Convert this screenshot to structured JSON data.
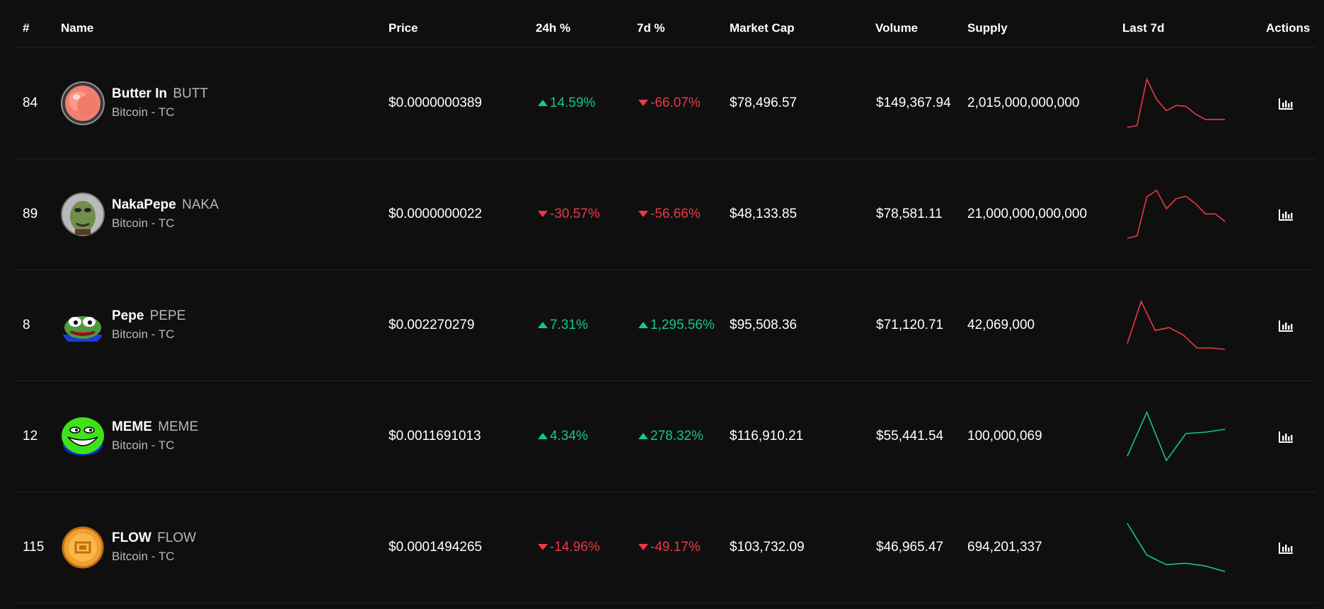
{
  "colors": {
    "background": "#0f0f10",
    "positive": "#16c784",
    "negative": "#ea3943",
    "spark_up": "#16c784",
    "spark_down": "#ea3943"
  },
  "header": {
    "rank": "#",
    "name": "Name",
    "price": "Price",
    "change_24h": "24h %",
    "change_7d": "7d %",
    "market_cap": "Market Cap",
    "volume": "Volume",
    "supply": "Supply",
    "last_7d": "Last 7d",
    "actions": "Actions"
  },
  "rows": [
    {
      "rank": "84",
      "name": "Butter In",
      "symbol": "BUTT",
      "network": "Bitcoin - TC",
      "icon": "peach-icon",
      "price": "$0.0000000389",
      "change_24h": "14.59%",
      "change_24h_dir": "up",
      "change_7d": "-66.07%",
      "change_7d_dir": "down",
      "market_cap": "$78,496.57",
      "volume": "$149,367.94",
      "supply": "2,015,000,000,000",
      "spark_dir": "down",
      "spark": [
        5,
        7,
        60,
        37,
        24,
        30,
        29,
        20,
        14,
        14,
        14
      ]
    },
    {
      "rank": "89",
      "name": "NakaPepe",
      "symbol": "NAKA",
      "network": "Bitcoin - TC",
      "icon": "naka-pepe-icon",
      "price": "$0.0000000022",
      "change_24h": "-30.57%",
      "change_24h_dir": "down",
      "change_7d": "-56.66%",
      "change_7d_dir": "down",
      "market_cap": "$48,133.85",
      "volume": "$78,581.11",
      "supply": "21,000,000,000,000",
      "spark_dir": "down",
      "spark": [
        5,
        8,
        54,
        62,
        40,
        52,
        55,
        46,
        34,
        34,
        25
      ]
    },
    {
      "rank": "8",
      "name": "Pepe",
      "symbol": "PEPE",
      "network": "Bitcoin - TC",
      "icon": "pepe-frog-icon",
      "price": "$0.002270279",
      "change_24h": "7.31%",
      "change_24h_dir": "up",
      "change_7d": "1,295.56%",
      "change_7d_dir": "up",
      "market_cap": "$95,508.36",
      "volume": "$71,120.71",
      "supply": "42,069,000",
      "spark_dir": "down",
      "spark": [
        12,
        70,
        30,
        34,
        24,
        6,
        6,
        4
      ]
    },
    {
      "rank": "12",
      "name": "MEME",
      "symbol": "MEME",
      "network": "Bitcoin - TC",
      "icon": "troll-face-icon",
      "price": "$0.0011691013",
      "change_24h": "4.34%",
      "change_24h_dir": "up",
      "change_7d": "278.32%",
      "change_7d_dir": "up",
      "market_cap": "$116,910.21",
      "volume": "$55,441.54",
      "supply": "100,000,069",
      "spark_dir": "up",
      "spark": [
        8,
        70,
        2,
        40,
        42,
        46
      ]
    },
    {
      "rank": "115",
      "name": "FLOW",
      "symbol": "FLOW",
      "network": "Bitcoin - TC",
      "icon": "flow-coin-icon",
      "price": "$0.0001494265",
      "change_24h": "-14.96%",
      "change_24h_dir": "down",
      "change_7d": "-49.17%",
      "change_7d_dir": "down",
      "market_cap": "$103,732.09",
      "volume": "$46,965.47",
      "supply": "694,201,337",
      "spark_dir": "up",
      "spark": [
        70,
        24,
        10,
        12,
        8,
        0
      ]
    }
  ]
}
